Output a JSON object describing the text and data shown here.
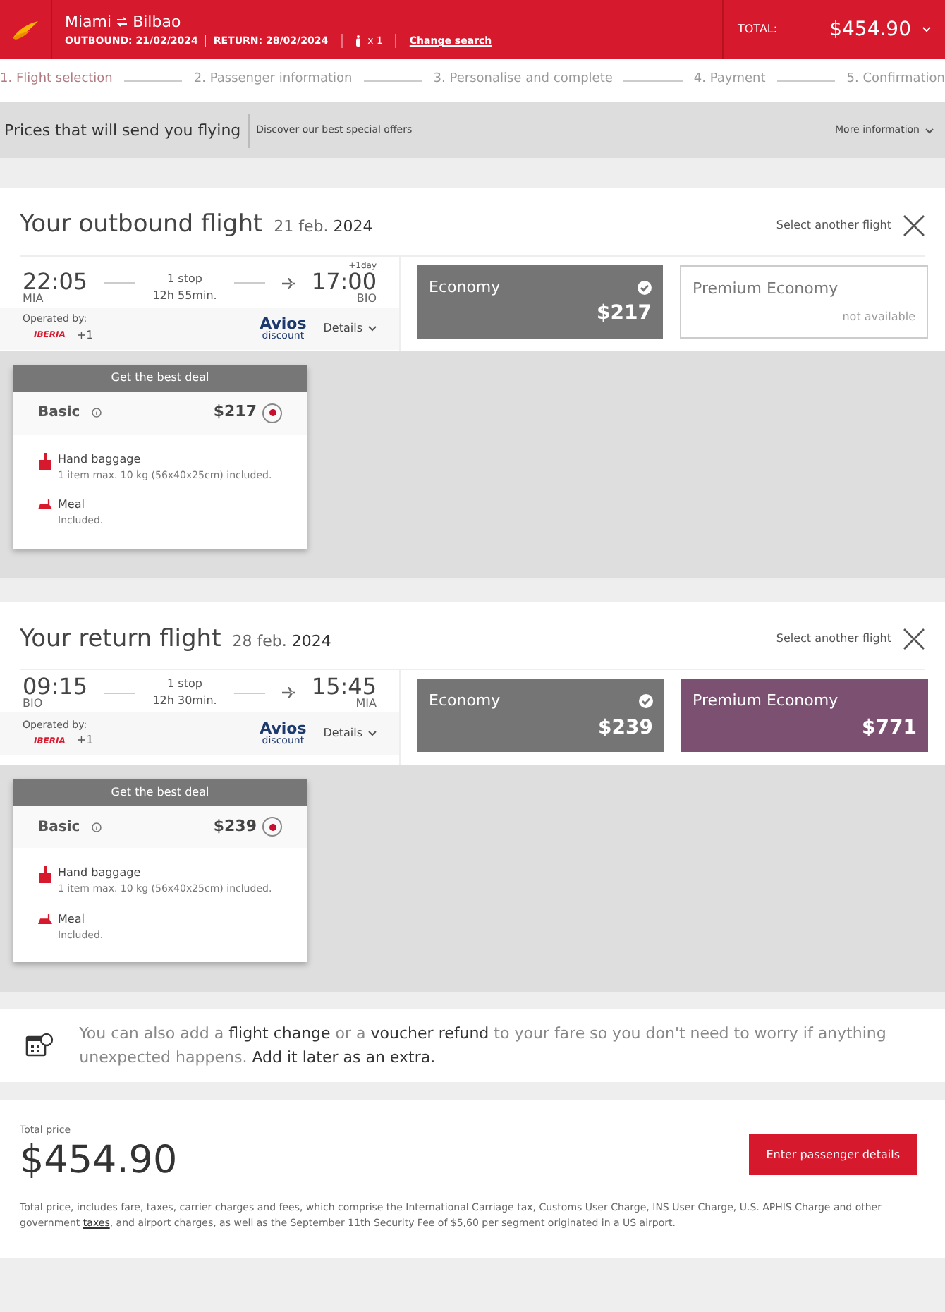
{
  "header": {
    "origin": "Miami",
    "destination": "Bilbao",
    "outbound": "OUTBOUND: 21/02/2024",
    "return": "RETURN: 28/02/2024",
    "passengers": "x 1",
    "change_search": "Change search",
    "total_label": "TOTAL:",
    "total": "$454.90"
  },
  "steps": [
    {
      "label": "1. Flight selection",
      "selected": true
    },
    {
      "label": "2. Passenger information",
      "selected": false
    },
    {
      "label": "3. Personalise and complete",
      "selected": false
    },
    {
      "label": "4. Payment",
      "selected": false
    },
    {
      "label": "5. Confirmation",
      "selected": false
    }
  ],
  "promo": {
    "title": "Prices that will send you flying",
    "subtitle": "Discover our best special offers",
    "more": "More information"
  },
  "flights": [
    {
      "title": "Your outbound flight",
      "date": "21 feb.",
      "year": "2024",
      "select_another": "Select another flight",
      "depart_time": "22:05",
      "depart_code": "MIA",
      "stops": "1 stop",
      "duration": "12h 55min.",
      "day_offset": "+1day",
      "arrive_time": "17:00",
      "arrive_code": "BIO",
      "operated_by": "Operated by:",
      "airline": "IBERIA",
      "more_airlines": "+1",
      "avios": "Avios",
      "avios_sub": "discount",
      "details": "Details",
      "fares": [
        {
          "name": "Economy",
          "price": "$217",
          "selected": true,
          "available": true
        },
        {
          "name": "Premium Economy",
          "note": "not available",
          "selected": false,
          "available": false
        }
      ],
      "deal": {
        "banner": "Get the best deal",
        "name": "Basic",
        "price": "$217",
        "selected": true,
        "features": [
          {
            "kind": "baggage",
            "title": "Hand baggage",
            "detail": "1 item max. 10 kg (56x40x25cm) included."
          },
          {
            "kind": "meal",
            "title": "Meal",
            "detail": "Included."
          }
        ]
      }
    },
    {
      "title": "Your return flight",
      "date": "28 feb.",
      "year": "2024",
      "select_another": "Select another flight",
      "depart_time": "09:15",
      "depart_code": "BIO",
      "stops": "1 stop",
      "duration": "12h 30min.",
      "arrive_time": "15:45",
      "arrive_code": "MIA",
      "operated_by": "Operated by:",
      "airline": "IBERIA",
      "more_airlines": "+1",
      "avios": "Avios",
      "avios_sub": "discount",
      "details": "Details",
      "fares": [
        {
          "name": "Economy",
          "price": "$239",
          "selected": true,
          "available": true
        },
        {
          "name": "Premium Economy",
          "price": "$771",
          "selected": false,
          "available": true
        }
      ],
      "deal": {
        "banner": "Get the best deal",
        "name": "Basic",
        "price": "$239",
        "selected": true,
        "features": [
          {
            "kind": "baggage",
            "title": "Hand baggage",
            "detail": "1 item max. 10 kg (56x40x25cm) included."
          },
          {
            "kind": "meal",
            "title": "Meal",
            "detail": "Included."
          }
        ]
      }
    }
  ],
  "extras_banner": "You can also add a **flight change** or a **voucher refund** to your fare so you don't need to worry if anything unexpected happens. **Add it later as an extra.**",
  "total": {
    "label": "Total price",
    "amount": "$454.90",
    "button": "Enter passenger details",
    "note_before": "Total price, includes fare, taxes, carrier charges and fees, which comprise the International Carriage tax, Customs User Charge, INS User Charge, U.S. APHIS Charge and other government",
    "note_link": "taxes",
    "note_after": ", and airport charges, as well as the September 11th Security Fee of $5,60 per segment originated in a US airport."
  }
}
